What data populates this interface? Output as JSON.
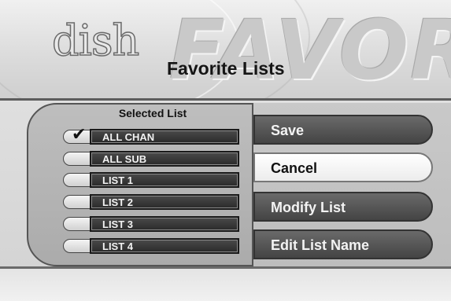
{
  "header": {
    "logo_text": "dish",
    "watermark_text": "FAVOR",
    "title": "Favorite Lists"
  },
  "selected_list": {
    "heading": "Selected List",
    "items": [
      {
        "label": "ALL CHAN",
        "checked": true
      },
      {
        "label": "ALL SUB",
        "checked": false
      },
      {
        "label": "LIST 1",
        "checked": false
      },
      {
        "label": "LIST 2",
        "checked": false
      },
      {
        "label": "LIST 3",
        "checked": false
      },
      {
        "label": "LIST 4",
        "checked": false
      }
    ],
    "check_icon": "checkmark-icon"
  },
  "menu": {
    "items": [
      {
        "label": "Save",
        "highlighted": false
      },
      {
        "label": "Cancel",
        "highlighted": true
      },
      {
        "label": "Modify List",
        "highlighted": false
      },
      {
        "label": "Edit List Name",
        "highlighted": false
      }
    ]
  },
  "colors": {
    "button_dark": "#555555",
    "button_highlight": "#ffffff",
    "list_label_bg": "#333333"
  }
}
